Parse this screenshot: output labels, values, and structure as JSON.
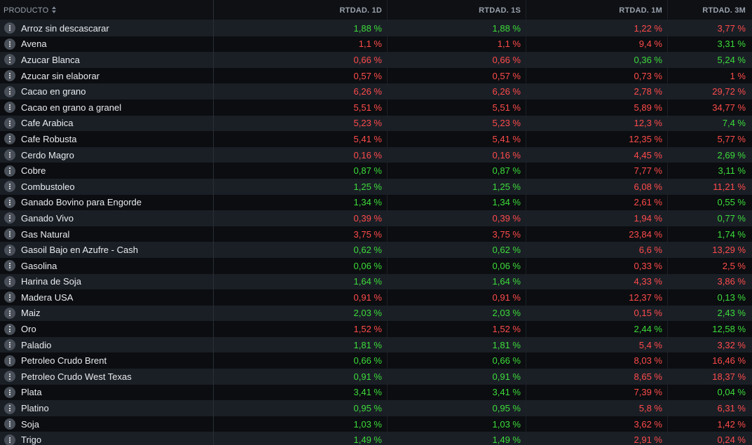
{
  "header": {
    "product": "PRODUCTO",
    "col1": "RTDAD. 1D",
    "col2": "RTDAD. 1S",
    "col3": "RTDAD. 1M",
    "col4": "RTDAD. 3M"
  },
  "colors": {
    "positive": "#3ddc3a",
    "negative": "#ff4b4b"
  },
  "rows": [
    {
      "name": "Arroz sin descascarar",
      "d1": "1,88 %",
      "s1": "1,88 %",
      "m1": "1,22 %",
      "m3": "3,77 %",
      "d1_pos": true,
      "s1_pos": true,
      "m1_pos": false,
      "m3_pos": false
    },
    {
      "name": "Avena",
      "d1": "1,1 %",
      "s1": "1,1 %",
      "m1": "9,4 %",
      "m3": "3,31 %",
      "d1_pos": false,
      "s1_pos": false,
      "m1_pos": false,
      "m3_pos": true
    },
    {
      "name": "Azucar Blanca",
      "d1": "0,66 %",
      "s1": "0,66 %",
      "m1": "0,36 %",
      "m3": "5,24 %",
      "d1_pos": false,
      "s1_pos": false,
      "m1_pos": true,
      "m3_pos": true
    },
    {
      "name": "Azucar sin elaborar",
      "d1": "0,57 %",
      "s1": "0,57 %",
      "m1": "0,73 %",
      "m3": "1 %",
      "d1_pos": false,
      "s1_pos": false,
      "m1_pos": false,
      "m3_pos": false
    },
    {
      "name": "Cacao en grano",
      "d1": "6,26 %",
      "s1": "6,26 %",
      "m1": "2,78 %",
      "m3": "29,72 %",
      "d1_pos": false,
      "s1_pos": false,
      "m1_pos": false,
      "m3_pos": false
    },
    {
      "name": "Cacao en grano a granel",
      "d1": "5,51 %",
      "s1": "5,51 %",
      "m1": "5,89 %",
      "m3": "34,77 %",
      "d1_pos": false,
      "s1_pos": false,
      "m1_pos": false,
      "m3_pos": false
    },
    {
      "name": "Cafe Arabica",
      "d1": "5,23 %",
      "s1": "5,23 %",
      "m1": "12,3 %",
      "m3": "7,4 %",
      "d1_pos": false,
      "s1_pos": false,
      "m1_pos": false,
      "m3_pos": true
    },
    {
      "name": "Cafe Robusta",
      "d1": "5,41 %",
      "s1": "5,41 %",
      "m1": "12,35 %",
      "m3": "5,77 %",
      "d1_pos": false,
      "s1_pos": false,
      "m1_pos": false,
      "m3_pos": false
    },
    {
      "name": "Cerdo Magro",
      "d1": "0,16 %",
      "s1": "0,16 %",
      "m1": "4,45 %",
      "m3": "2,69 %",
      "d1_pos": false,
      "s1_pos": false,
      "m1_pos": false,
      "m3_pos": true
    },
    {
      "name": "Cobre",
      "d1": "0,87 %",
      "s1": "0,87 %",
      "m1": "7,77 %",
      "m3": "3,11 %",
      "d1_pos": true,
      "s1_pos": true,
      "m1_pos": false,
      "m3_pos": true
    },
    {
      "name": "Combustoleo",
      "d1": "1,25 %",
      "s1": "1,25 %",
      "m1": "6,08 %",
      "m3": "11,21 %",
      "d1_pos": true,
      "s1_pos": true,
      "m1_pos": false,
      "m3_pos": false
    },
    {
      "name": "Ganado Bovino para Engorde",
      "d1": "1,34 %",
      "s1": "1,34 %",
      "m1": "2,61 %",
      "m3": "0,55 %",
      "d1_pos": true,
      "s1_pos": true,
      "m1_pos": false,
      "m3_pos": true
    },
    {
      "name": "Ganado Vivo",
      "d1": "0,39 %",
      "s1": "0,39 %",
      "m1": "1,94 %",
      "m3": "0,77 %",
      "d1_pos": false,
      "s1_pos": false,
      "m1_pos": false,
      "m3_pos": true
    },
    {
      "name": "Gas Natural",
      "d1": "3,75 %",
      "s1": "3,75 %",
      "m1": "23,84 %",
      "m3": "1,74 %",
      "d1_pos": false,
      "s1_pos": false,
      "m1_pos": false,
      "m3_pos": true
    },
    {
      "name": "Gasoil Bajo en Azufre - Cash",
      "d1": "0,62 %",
      "s1": "0,62 %",
      "m1": "6,6 %",
      "m3": "13,29 %",
      "d1_pos": true,
      "s1_pos": true,
      "m1_pos": false,
      "m3_pos": false
    },
    {
      "name": "Gasolina",
      "d1": "0,06 %",
      "s1": "0,06 %",
      "m1": "0,33 %",
      "m3": "2,5 %",
      "d1_pos": true,
      "s1_pos": true,
      "m1_pos": false,
      "m3_pos": false
    },
    {
      "name": "Harina de Soja",
      "d1": "1,64 %",
      "s1": "1,64 %",
      "m1": "4,33 %",
      "m3": "3,86 %",
      "d1_pos": true,
      "s1_pos": true,
      "m1_pos": false,
      "m3_pos": false
    },
    {
      "name": "Madera USA",
      "d1": "0,91 %",
      "s1": "0,91 %",
      "m1": "12,37 %",
      "m3": "0,13 %",
      "d1_pos": false,
      "s1_pos": false,
      "m1_pos": false,
      "m3_pos": true
    },
    {
      "name": "Maiz",
      "d1": "2,03 %",
      "s1": "2,03 %",
      "m1": "0,15 %",
      "m3": "2,43 %",
      "d1_pos": true,
      "s1_pos": true,
      "m1_pos": false,
      "m3_pos": true
    },
    {
      "name": "Oro",
      "d1": "1,52 %",
      "s1": "1,52 %",
      "m1": "2,44 %",
      "m3": "12,58 %",
      "d1_pos": false,
      "s1_pos": false,
      "m1_pos": true,
      "m3_pos": true
    },
    {
      "name": "Paladio",
      "d1": "1,81 %",
      "s1": "1,81 %",
      "m1": "5,4 %",
      "m3": "3,32 %",
      "d1_pos": true,
      "s1_pos": true,
      "m1_pos": false,
      "m3_pos": false
    },
    {
      "name": "Petroleo Crudo Brent",
      "d1": "0,66 %",
      "s1": "0,66 %",
      "m1": "8,03 %",
      "m3": "16,46 %",
      "d1_pos": true,
      "s1_pos": true,
      "m1_pos": false,
      "m3_pos": false
    },
    {
      "name": "Petroleo Crudo West Texas",
      "d1": "0,91 %",
      "s1": "0,91 %",
      "m1": "8,65 %",
      "m3": "18,37 %",
      "d1_pos": true,
      "s1_pos": true,
      "m1_pos": false,
      "m3_pos": false
    },
    {
      "name": "Plata",
      "d1": "3,41 %",
      "s1": "3,41 %",
      "m1": "7,39 %",
      "m3": "0,04 %",
      "d1_pos": true,
      "s1_pos": true,
      "m1_pos": false,
      "m3_pos": true
    },
    {
      "name": "Platino",
      "d1": "0,95 %",
      "s1": "0,95 %",
      "m1": "5,8 %",
      "m3": "6,31 %",
      "d1_pos": true,
      "s1_pos": true,
      "m1_pos": false,
      "m3_pos": false
    },
    {
      "name": "Soja",
      "d1": "1,03 %",
      "s1": "1,03 %",
      "m1": "3,62 %",
      "m3": "1,42 %",
      "d1_pos": true,
      "s1_pos": true,
      "m1_pos": false,
      "m3_pos": false
    },
    {
      "name": "Trigo",
      "d1": "1,49 %",
      "s1": "1,49 %",
      "m1": "2,91 %",
      "m3": "0,24 %",
      "d1_pos": true,
      "s1_pos": true,
      "m1_pos": false,
      "m3_pos": false
    }
  ]
}
